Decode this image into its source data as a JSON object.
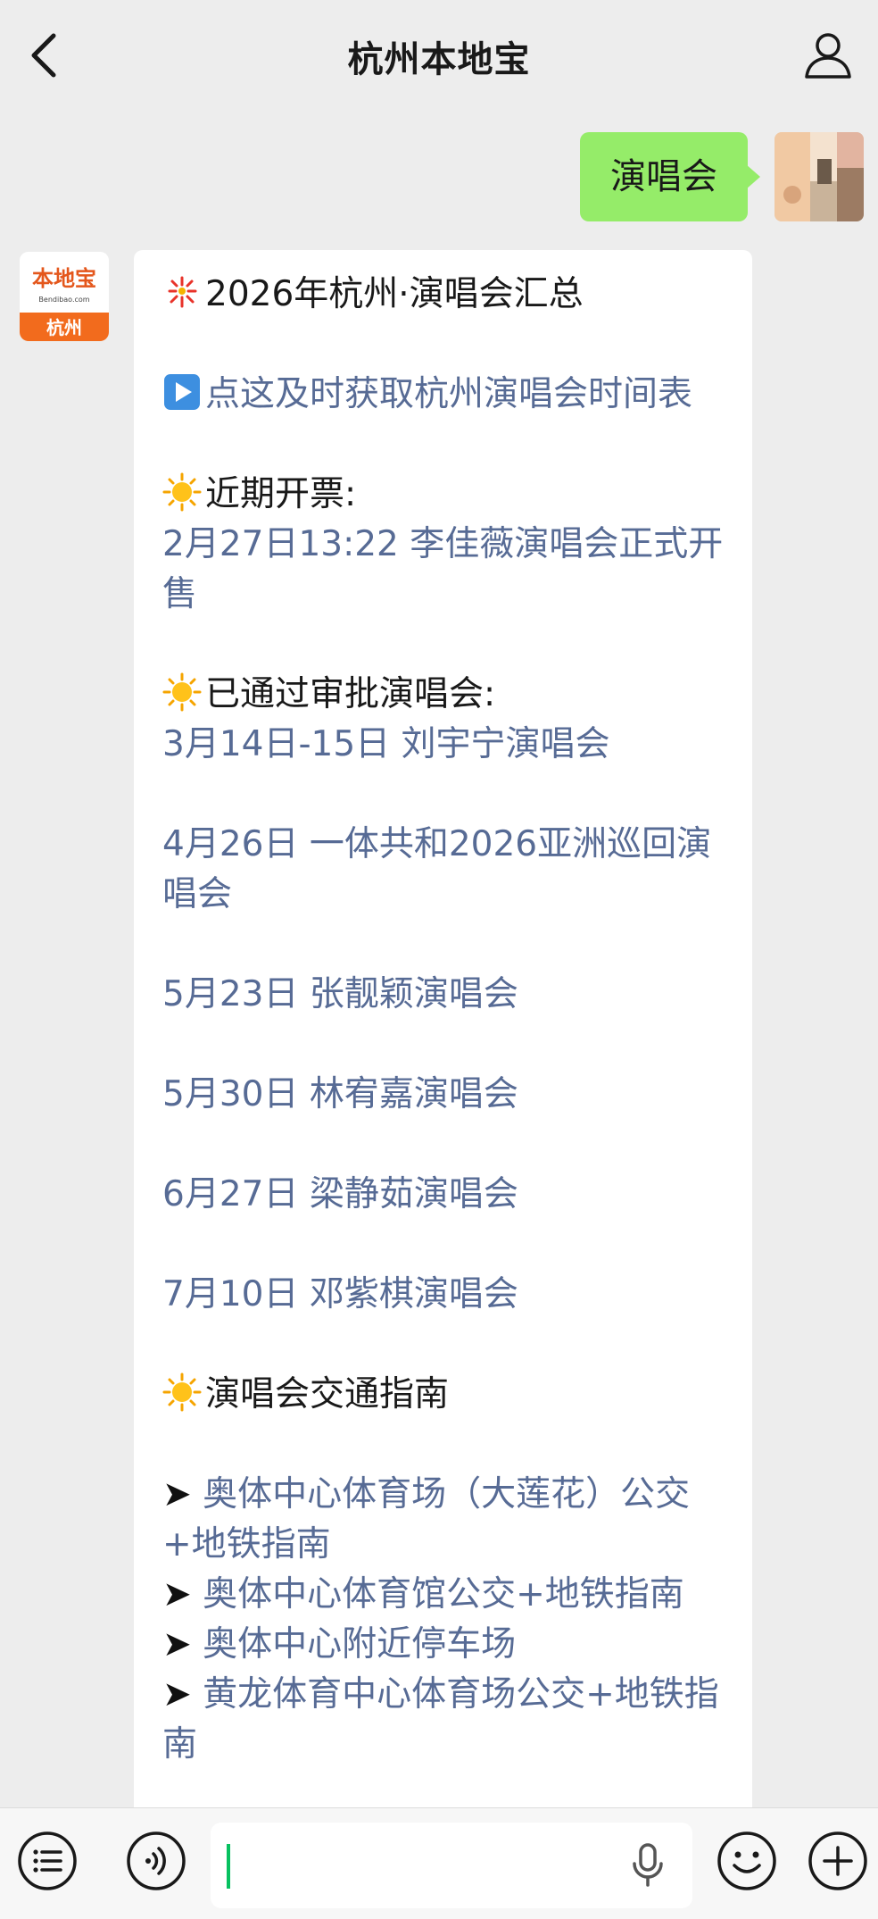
{
  "header": {
    "title": "杭州本地宝",
    "back_icon": "chevron-left-icon",
    "profile_icon": "person-icon"
  },
  "outgoing": {
    "text": "演唱会"
  },
  "bot": {
    "avatar_top": "本地宝",
    "avatar_sub": "Bendibao.com",
    "avatar_city": "杭州"
  },
  "message": {
    "title": "2026年杭州·演唱会汇总",
    "timetable_link": "点这及时获取杭州演唱会时间表",
    "sale_heading": "近期开票:",
    "sale_item": "2月27日13:22  李佳薇演唱会正式开售",
    "approved_heading": "已通过审批演唱会:",
    "concerts": [
      "3月14日-15日 刘宇宁演唱会",
      "4月26日 一体共和2026亚洲巡回演唱会",
      "5月23日 张靓颖演唱会",
      "5月30日 林宥嘉演唱会",
      "6月27日 梁静茹演唱会",
      "7月10日 邓紫棋演唱会"
    ],
    "traffic_heading": "演唱会交通指南",
    "guides": [
      "奥体中心体育场（大莲花）公交+地铁指南",
      "奥体中心体育馆公交+地铁指南",
      "奥体中心附近停车场",
      "黄龙体育中心体育场公交+地铁指南"
    ]
  },
  "colors": {
    "background": "#ededed",
    "outgoing_bubble": "#95ec69",
    "link": "#576b95",
    "bot_brand": "#f26b1d"
  }
}
